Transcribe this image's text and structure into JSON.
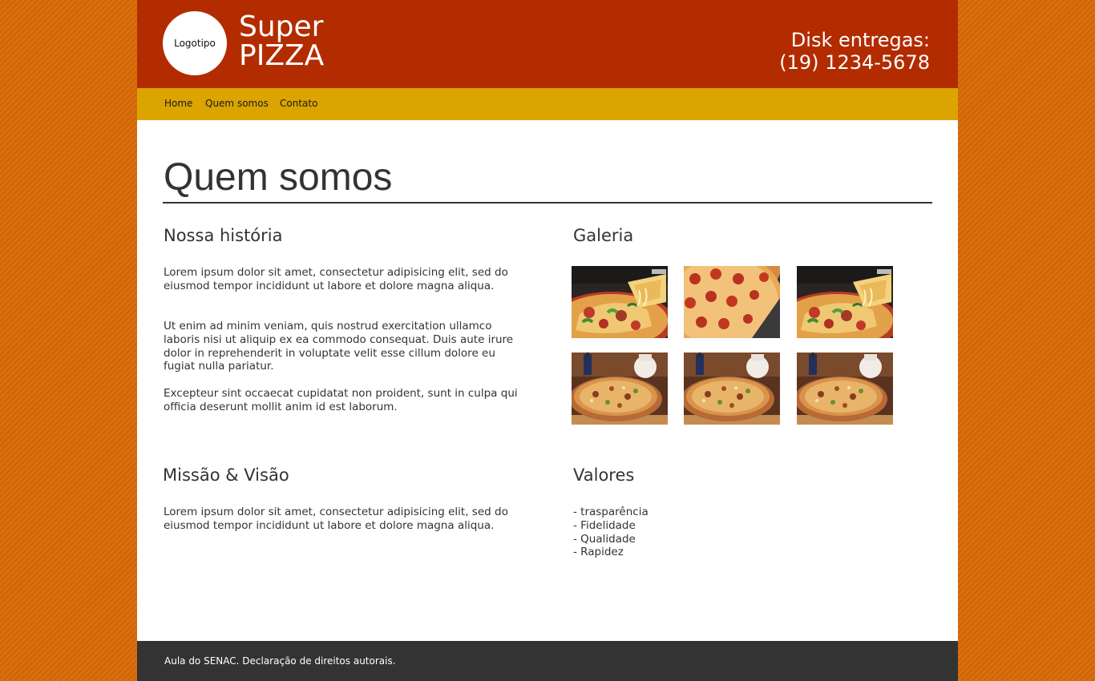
{
  "header": {
    "logo_text": "Logotipo",
    "brand_line1": "Super",
    "brand_line2": "PIZZA",
    "delivery_line1": "Disk entregas:",
    "delivery_line2": "(19) 1234-5678"
  },
  "nav": {
    "items": [
      {
        "label": "Home"
      },
      {
        "label": "Quem somos"
      },
      {
        "label": "Contato"
      }
    ]
  },
  "main": {
    "title": "Quem somos",
    "history": {
      "title": "Nossa história",
      "paragraphs": [
        "Lorem ipsum dolor sit amet, consectetur adipisicing elit, sed do eiusmod tempor incididunt ut labore et dolore magna aliqua.",
        "Ut enim ad minim veniam, quis nostrud exercitation ullamco laboris nisi ut aliquip ex ea commodo consequat. Duis aute irure dolor in reprehenderit in voluptate velit esse cillum dolore eu fugiat nulla pariatur.",
        "Excepteur sint occaecat cupidatat non proident, sunt in culpa qui officia deserunt mollit anim id est laborum."
      ]
    },
    "gallery": {
      "title": "Galeria",
      "images": [
        {
          "kind": "pizza-slice-lift"
        },
        {
          "kind": "pepperoni-pizza"
        },
        {
          "kind": "pizza-slice-lift"
        },
        {
          "kind": "pizza-table-setting"
        },
        {
          "kind": "pizza-table-setting"
        },
        {
          "kind": "pizza-table-setting"
        }
      ]
    },
    "mission": {
      "title": "Missão & Visão",
      "paragraph": "Lorem ipsum dolor sit amet, consectetur adipisicing elit, sed do eiusmod tempor incididunt ut labore et dolore magna aliqua."
    },
    "values": {
      "title": "Valores",
      "items": [
        "- trasparência",
        "- Fidelidade",
        "- Qualidade",
        "- Rapidez"
      ]
    }
  },
  "footer": {
    "text": "Aula do SENAC. Declaração de direitos autorais."
  },
  "colors": {
    "background": "#d96a05",
    "header": "#b22c00",
    "nav": "#dba400",
    "footer": "#333333",
    "text": "#333333"
  }
}
